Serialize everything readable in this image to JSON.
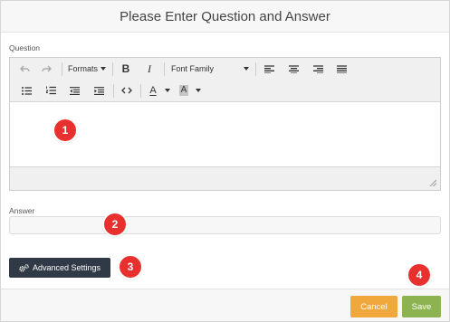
{
  "dialog": {
    "title": "Please Enter Question and Answer"
  },
  "question": {
    "label": "Question",
    "toolbar": {
      "formats_label": "Formats",
      "bold_label": "B",
      "italic_label": "I",
      "font_family_label": "Font Family",
      "text_color_label": "A",
      "bg_color_label": "A",
      "icons": [
        "undo-icon",
        "redo-icon",
        "align-left-icon",
        "align-center-icon",
        "align-right-icon",
        "align-justify-icon",
        "bullet-list-icon",
        "numbered-list-icon",
        "outdent-icon",
        "indent-icon",
        "code-icon"
      ]
    },
    "value": ""
  },
  "answer": {
    "label": "Answer",
    "value": "",
    "placeholder": ""
  },
  "advanced_settings": {
    "label": "Advanced Settings",
    "icon": "gears-icon"
  },
  "footer": {
    "cancel_label": "Cancel",
    "save_label": "Save"
  },
  "markers": [
    "1",
    "2",
    "3",
    "4"
  ],
  "colors": {
    "marker": "#e8312f",
    "cancel": "#f0a73c",
    "save": "#8cb34f",
    "advanced": "#2f3a46"
  }
}
